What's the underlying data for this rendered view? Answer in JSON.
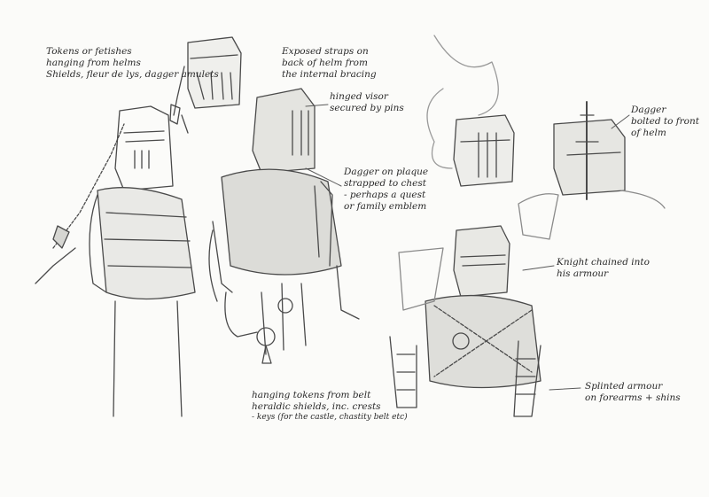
{
  "notes": {
    "tokens": [
      "Tokens or fetishes",
      "hanging from helms",
      "Shields, fleur de lys, dagger amulets"
    ],
    "straps": [
      "Exposed straps on",
      "back of helm from",
      "the internal bracing"
    ],
    "visor": [
      "hinged visor",
      "secured by pins"
    ],
    "dagger_plate": [
      "Dagger on plaque",
      "strapped to chest",
      "- perhaps a quest",
      "or family emblem"
    ],
    "dagger_helm": [
      "Dagger",
      "bolted to front",
      "of helm"
    ],
    "chained": [
      "Knight chained into",
      "his armour"
    ],
    "splinted": [
      "Splinted armour",
      "on forearms + shins"
    ],
    "belt": [
      "hanging tokens from belt",
      "heraldic shields, inc. crests",
      "- keys (for the castle, chastity belt etc)"
    ]
  }
}
